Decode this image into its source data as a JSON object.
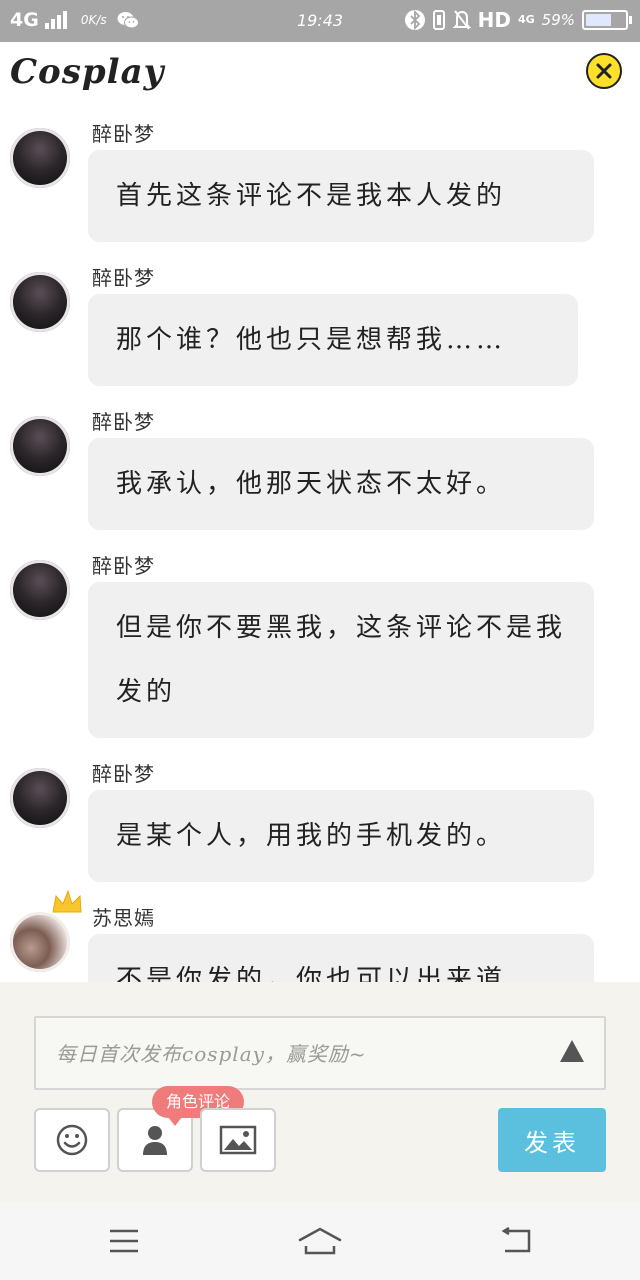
{
  "status_bar": {
    "network": "4G",
    "speed": "0K/s",
    "time": "19:43",
    "hd": "HD",
    "mobile_data": "4G",
    "battery_percent": "59%",
    "battery_level": 0.59,
    "icons": [
      "signal-icon",
      "wechat-icon",
      "bluetooth-icon",
      "vibrate-icon",
      "mute-bell-icon",
      "battery-icon"
    ]
  },
  "header": {
    "title": "Cosplay",
    "close_icon": "close-icon",
    "accent_color": "#fde02a"
  },
  "messages": [
    {
      "name": "醉卧梦",
      "text": "首先这条评论不是我本人发的"
    },
    {
      "name": "醉卧梦",
      "text": "那个谁？他也只是想帮我……"
    },
    {
      "name": "醉卧梦",
      "text": "我承认，他那天状态不太好。"
    },
    {
      "name": "醉卧梦",
      "text": "但是你不要黑我，这条评论不是我发的"
    },
    {
      "name": "醉卧梦",
      "text": "是某个人，用我的手机发的。"
    },
    {
      "name": "苏思嫣",
      "text": "不是你发的，你也可以出来道"
    }
  ],
  "composer": {
    "placeholder": "每日首次发布cosplay，赢奖励~",
    "role_badge": "角色评论",
    "publish_label": "发表",
    "publish_color": "#5bc0de",
    "tools": [
      "emoji-icon",
      "person-icon",
      "image-icon"
    ]
  },
  "nav": {
    "icons": [
      "menu-icon",
      "home-icon",
      "back-icon"
    ]
  }
}
